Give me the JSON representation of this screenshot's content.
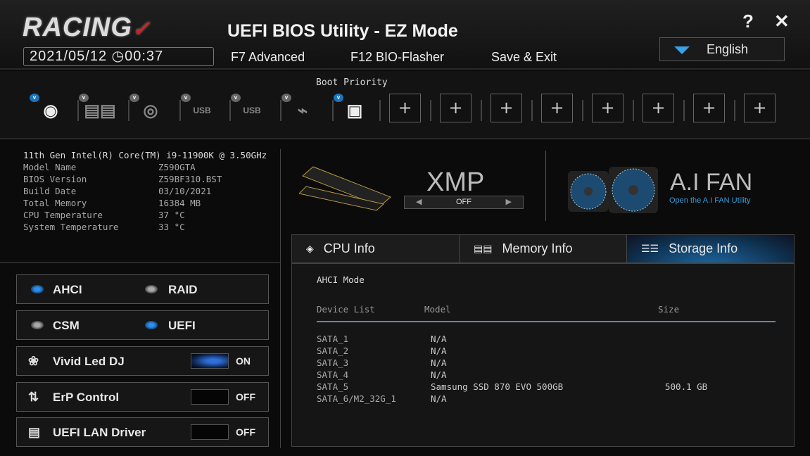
{
  "header": {
    "logo": "RACING",
    "title": "UEFI BIOS Utility - EZ Mode",
    "date": "2021/05/12",
    "time": "00:37",
    "menu": [
      "F7 Advanced",
      "F12 BIO-Flasher",
      "Save & Exit"
    ],
    "language": "English",
    "help": "?",
    "close": "✕"
  },
  "boot": {
    "label": "Boot Priority",
    "devices": [
      {
        "name": "Hard Drive",
        "icon": "hdd-icon",
        "checked": true
      },
      {
        "name": "Network",
        "icon": "memory-icon",
        "checked": false
      },
      {
        "name": "Optical",
        "icon": "cd-icon",
        "checked": false
      },
      {
        "name": "USB HDD",
        "icon": "usb-hdd-icon",
        "text": "USB",
        "checked": false
      },
      {
        "name": "USB CD",
        "icon": "usb-cd-icon",
        "text": "USB",
        "checked": false
      },
      {
        "name": "USB Key",
        "icon": "usb-stick-icon",
        "checked": false
      },
      {
        "name": "LAN",
        "icon": "lan-icon",
        "checked": true
      }
    ],
    "empty_slots": 8,
    "plus": "+",
    "accent": "#1a75c0"
  },
  "sysinfo": {
    "cpu": "11th Gen Intel(R) Core(TM) i9-11900K @ 3.50GHz",
    "rows": [
      {
        "k": "Model Name",
        "v": "Z590GTA"
      },
      {
        "k": "BIOS Version",
        "v": "Z59BF310.BST"
      },
      {
        "k": "Build Date",
        "v": "03/10/2021"
      },
      {
        "k": "Total Memory",
        "v": "16384 MB"
      },
      {
        "k": "CPU Temperature",
        "v": "37  °C"
      },
      {
        "k": "System Temperature",
        "v": "33  °C"
      }
    ]
  },
  "options": {
    "sata": {
      "a": "AHCI",
      "b": "RAID",
      "selected": "AHCI"
    },
    "boot_mode": {
      "a": "CSM",
      "b": "UEFI",
      "selected": "UEFI"
    },
    "toggles": [
      {
        "label": "Vivid Led DJ",
        "state": "ON",
        "icon": "led-icon"
      },
      {
        "label": "ErP Control",
        "state": "OFF",
        "icon": "erp-icon"
      },
      {
        "label": "UEFI LAN Driver",
        "state": "OFF",
        "icon": "lan-icon"
      }
    ]
  },
  "xmp": {
    "title": "XMP",
    "value": "OFF"
  },
  "aifan": {
    "title": "A.I FAN",
    "subtitle": "Open the A.I FAN Utility"
  },
  "tabs": [
    {
      "label": "CPU Info"
    },
    {
      "label": "Memory Info"
    },
    {
      "label": "Storage Info",
      "active": true
    }
  ],
  "storage": {
    "mode": "AHCI Mode",
    "headers": [
      "Device List",
      "Model",
      "Size"
    ],
    "rows": [
      {
        "port": "SATA_1",
        "model": "N/A",
        "size": ""
      },
      {
        "port": "SATA_2",
        "model": "N/A",
        "size": ""
      },
      {
        "port": "SATA_3",
        "model": "N/A",
        "size": ""
      },
      {
        "port": "SATA_4",
        "model": "N/A",
        "size": ""
      },
      {
        "port": "SATA_5",
        "model": "Samsung SSD 870 EVO 500GB",
        "size": "500.1 GB"
      },
      {
        "port": "SATA_6/M2_32G_1",
        "model": "N/A",
        "size": ""
      }
    ]
  }
}
